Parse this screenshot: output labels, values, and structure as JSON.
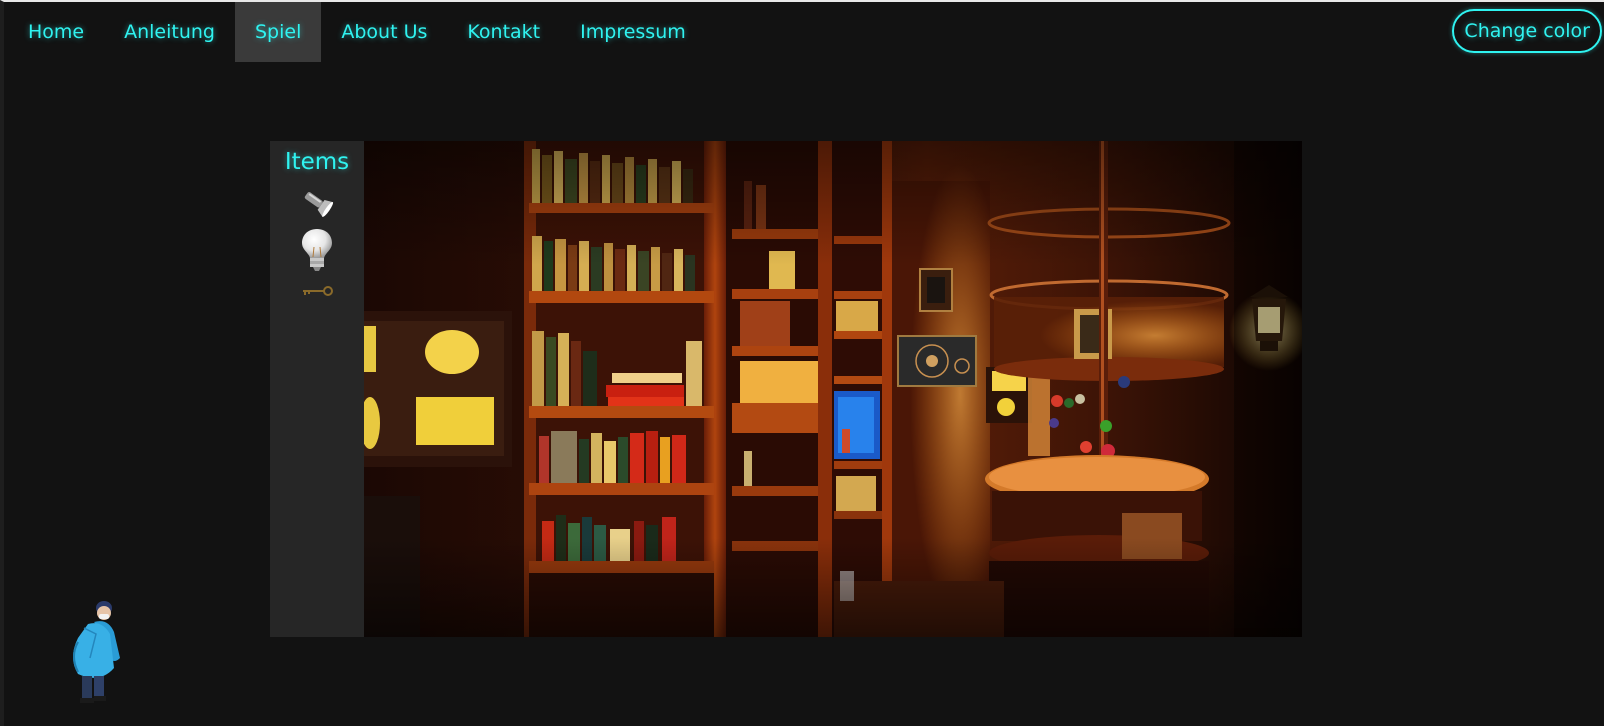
{
  "nav": {
    "items": [
      {
        "label": "Home"
      },
      {
        "label": "Anleitung"
      },
      {
        "label": "Spiel",
        "active": true
      },
      {
        "label": "About Us"
      },
      {
        "label": "Kontakt"
      },
      {
        "label": "Impressum"
      }
    ]
  },
  "change_color_label": "Change color",
  "items_panel": {
    "title": "Items",
    "items": [
      {
        "icon": "flashlight-icon"
      },
      {
        "icon": "lightbulb-icon"
      },
      {
        "icon": "key-icon"
      }
    ]
  },
  "scene": {
    "icon": "library-room-scene"
  },
  "player": {
    "icon": "player-character"
  },
  "colors": {
    "accent": "#2ff3f0",
    "background": "#121212",
    "panel": "#262626",
    "active_tab": "#3a3a3a"
  }
}
